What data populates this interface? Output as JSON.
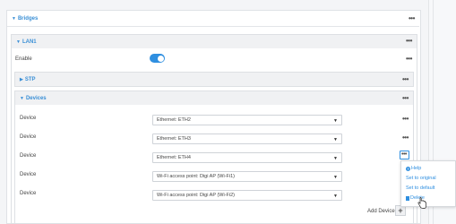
{
  "bridges": {
    "label": "Bridges",
    "arrow": "▼"
  },
  "lan1": {
    "label": "LAN1",
    "arrow": "▼"
  },
  "enable": {
    "label": "Enable",
    "value": true
  },
  "stp": {
    "label": "STP",
    "arrow": "▶"
  },
  "devices": {
    "label": "Devices",
    "arrow": "▼",
    "rows": [
      {
        "label": "Device",
        "value": "Ethernet: ETH2"
      },
      {
        "label": "Device",
        "value": "Ethernet: ETH3"
      },
      {
        "label": "Device",
        "value": "Ethernet: ETH4"
      },
      {
        "label": "Device",
        "value": "Wi-Fi access point: Digi AP (Wi-Fi1)"
      },
      {
        "label": "Device",
        "value": "Wi-Fi access point: Digi AP (Wi-Fi2)"
      }
    ]
  },
  "menu": {
    "help": "Help",
    "set_to_original": "Set to original",
    "set_to_default": "Set to default",
    "delete": "Delete"
  },
  "add_device": {
    "label": "Add Device",
    "plus": "+"
  },
  "dots": "•••",
  "colors": {
    "accent": "#2f8fe0",
    "header_text": "#3a8fd6"
  },
  "icons": {
    "help": "help-icon",
    "delete": "trash-icon",
    "more": "more-options-icon",
    "add": "plus-icon",
    "cursor": "hand-cursor-icon"
  }
}
